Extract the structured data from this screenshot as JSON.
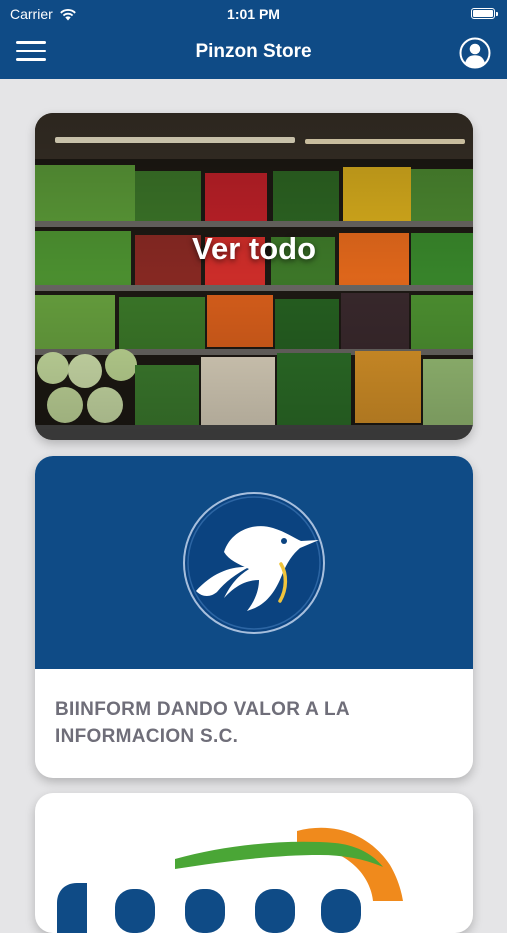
{
  "status_bar": {
    "carrier": "Carrier",
    "time": "1:01 PM",
    "wifi_icon": "wifi-icon",
    "battery_icon": "battery-icon"
  },
  "navbar": {
    "title": "Pinzon Store",
    "menu_icon": "hamburger-menu-icon",
    "profile_icon": "user-profile-icon",
    "background_color": "#0f4b86"
  },
  "cards": [
    {
      "type": "category",
      "label": "Ver todo",
      "image": "produce-shelves-photo"
    },
    {
      "type": "store",
      "name": "BIINFORM DANDO VALOR A LA INFORMACION S.C.",
      "logo": "penguin-logo",
      "banner_color": "#0f4b86",
      "name_color": "#6f6e79"
    },
    {
      "type": "store",
      "logo": "partial-orange-green-blue-logo"
    }
  ]
}
